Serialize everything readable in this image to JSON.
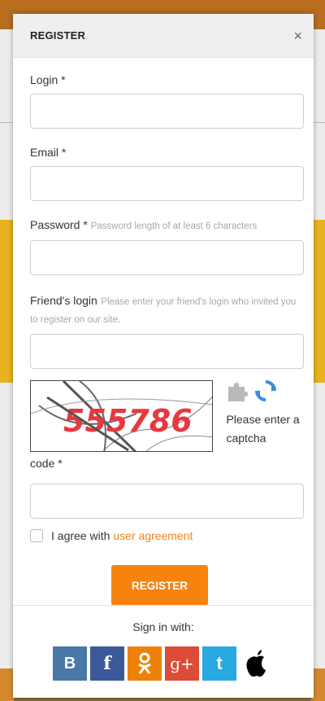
{
  "modal": {
    "title": "REGISTER",
    "close_glyph": "×"
  },
  "form": {
    "login": {
      "label": "Login",
      "required": "*",
      "value": ""
    },
    "email": {
      "label": "Email",
      "required": "*",
      "value": ""
    },
    "password": {
      "label": "Password",
      "required": "*",
      "hint": "Password length of at least 6 characters",
      "value": ""
    },
    "friend": {
      "label": "Friend's login",
      "hint": "Please enter your friend's login who invited you to register on our site.",
      "value": ""
    },
    "captcha": {
      "image_text": "555786",
      "side_text": "Please enter a captcha",
      "side_text_cont": "code",
      "required": "*",
      "value": "",
      "icons": [
        "puzzle-icon",
        "refresh-icon"
      ]
    },
    "agree": {
      "text": "I agree with",
      "link": "user agreement",
      "checked": false
    },
    "submit_label": "REGISTER"
  },
  "footer": {
    "signin_label": "Sign in with:",
    "social": [
      {
        "name": "vk",
        "glyph": "B",
        "color": "#4a76a8"
      },
      {
        "name": "facebook",
        "glyph": "f",
        "color": "#3b5998"
      },
      {
        "name": "odnoklassniki",
        "glyph": "ok",
        "color": "#ee8208"
      },
      {
        "name": "google-plus",
        "glyph": "8+",
        "color": "#dd4b39"
      },
      {
        "name": "twitter",
        "glyph": "t",
        "color": "#29a9e1"
      },
      {
        "name": "apple",
        "glyph": "apple",
        "color": "#ffffff"
      }
    ]
  },
  "colors": {
    "accent": "#f7830f",
    "link": "#f0831f",
    "captcha_text": "#e8383e"
  }
}
